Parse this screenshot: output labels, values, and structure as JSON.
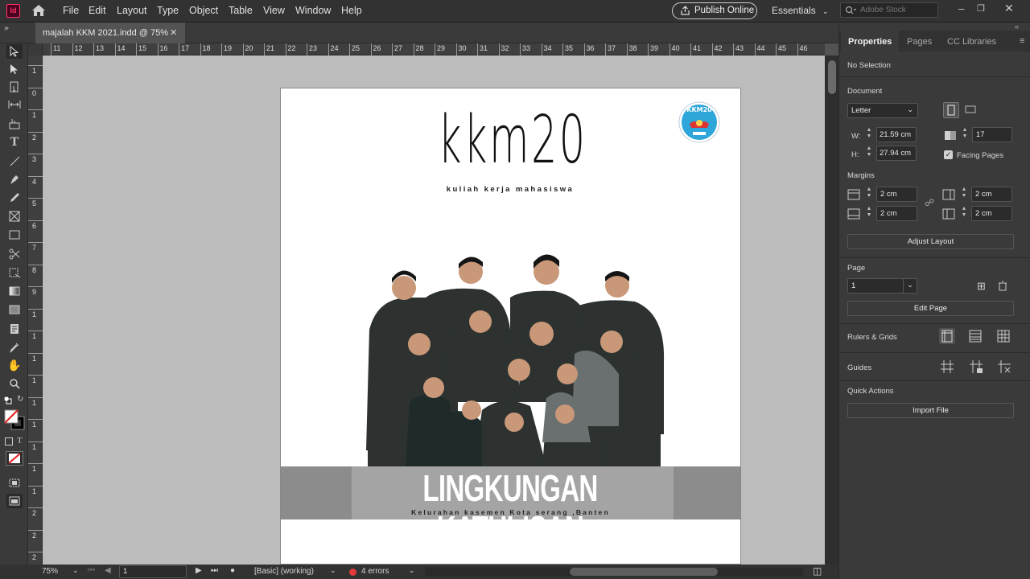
{
  "menubar": {
    "app_icon": "Id",
    "items": [
      "File",
      "Edit",
      "Layout",
      "Type",
      "Object",
      "Table",
      "View",
      "Window",
      "Help"
    ],
    "publish_label": "Publish Online",
    "workspace_label": "Essentials",
    "search_placeholder": "Adobe Stock"
  },
  "document_tab": {
    "label": "majalah KKM 2021.indd @ 75%"
  },
  "ruler": {
    "h_ticks": [
      "11",
      "12",
      "13",
      "14",
      "15",
      "16",
      "17",
      "18",
      "19",
      "20",
      "21",
      "22",
      "23",
      "24",
      "25",
      "26",
      "27",
      "28",
      "29",
      "30",
      "31",
      "32",
      "33",
      "34",
      "35",
      "36",
      "37",
      "38",
      "39",
      "40",
      "41",
      "42",
      "43",
      "44",
      "45",
      "46"
    ],
    "v_ticks": [
      "1",
      "0",
      "1",
      "2",
      "3",
      "4",
      "5",
      "6",
      "7",
      "8",
      "9",
      "1",
      "1",
      "1",
      "1",
      "1",
      "1",
      "1",
      "1",
      "1",
      "2",
      "2",
      "2"
    ]
  },
  "page": {
    "logo_text": "kkm20",
    "logo_subtitle": "kuliah kerja mahasiswa",
    "badge_text": "KKM20",
    "banner_title": "LINGKUNGAN KATULISAN",
    "banner_subtitle": "Kelurahan kasemen Kota serang ,Banten"
  },
  "status": {
    "zoom": "75%",
    "page_number": "1",
    "preflight_profile": "[Basic] (working)",
    "errors": "4 errors",
    "error_color": "#e03a3a"
  },
  "properties_panel": {
    "tabs": [
      "Properties",
      "Pages",
      "CC Libraries"
    ],
    "selection": "No Selection",
    "document_label": "Document",
    "page_size": "Letter",
    "width_label": "W:",
    "width_value": "21.59 cm",
    "height_label": "H:",
    "height_value": "27.94 cm",
    "pages_count": "17",
    "facing_pages_label": "Facing Pages",
    "facing_pages_checked": true,
    "margins_label": "Margins",
    "margin_top": "2 cm",
    "margin_bottom": "2 cm",
    "margin_inside": "2 cm",
    "margin_outside": "2 cm",
    "adjust_layout_label": "Adjust Layout",
    "page_label": "Page",
    "page_value": "1",
    "edit_page_label": "Edit Page",
    "rulers_grids_label": "Rulers & Grids",
    "guides_label": "Guides",
    "quick_actions_label": "Quick Actions",
    "import_file_label": "Import File"
  },
  "colors": {
    "accent": "#ff3366",
    "panel": "#3a3a3a",
    "canvas": "#bcbcbc",
    "chrome": "#323232"
  }
}
